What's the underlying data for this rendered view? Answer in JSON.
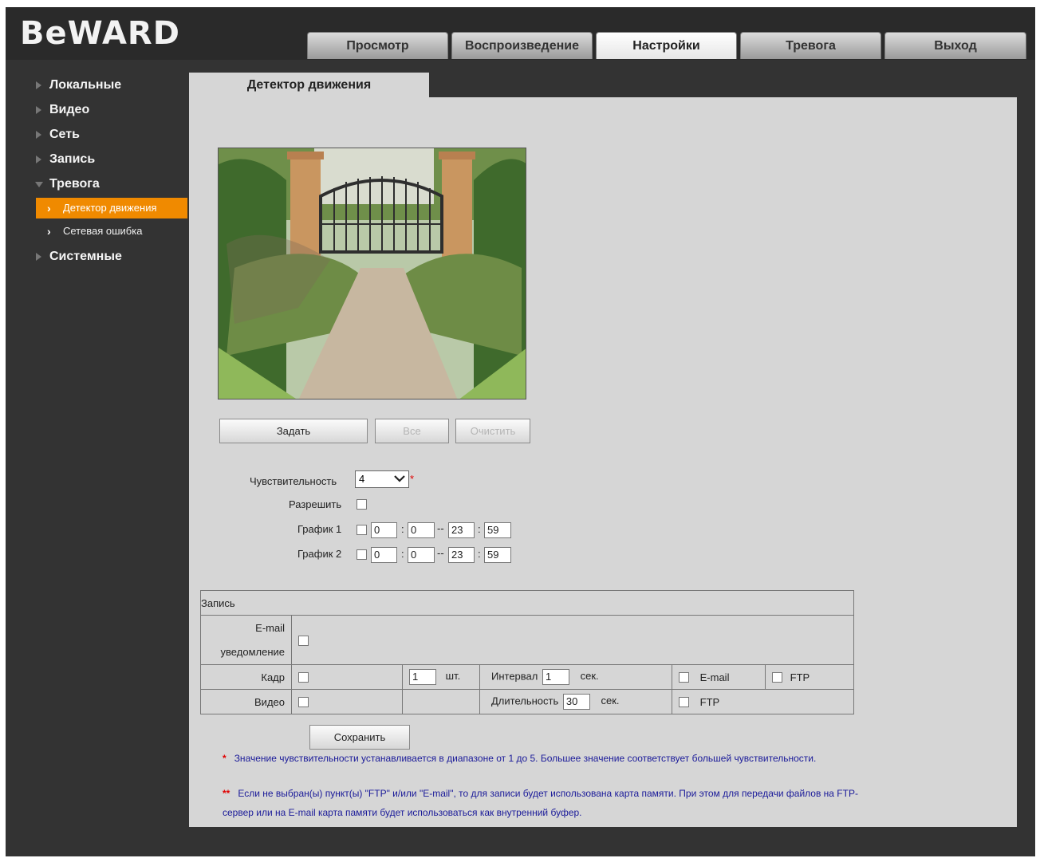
{
  "brand": {
    "logo_text": "BeWARD"
  },
  "tabs": [
    {
      "label": "Просмотр"
    },
    {
      "label": "Воспроизведение"
    },
    {
      "label": "Настройки"
    },
    {
      "label": "Тревога"
    },
    {
      "label": "Выход"
    }
  ],
  "sidebar": {
    "items": [
      {
        "label": "Локальные"
      },
      {
        "label": "Видео"
      },
      {
        "label": "Сеть"
      },
      {
        "label": "Запись"
      },
      {
        "label": "Тревога"
      },
      {
        "label": "Системные"
      }
    ],
    "subitems": [
      {
        "label": "Детектор движения"
      },
      {
        "label": "Сетевая ошибка"
      }
    ]
  },
  "page": {
    "title": "Детектор движения"
  },
  "area_buttons": {
    "set": "Задать",
    "all": "Все",
    "clear": "Очистить"
  },
  "form": {
    "sensitivity_label": "Чувствительность",
    "sensitivity_value": "4",
    "required_mark": "*",
    "enable_label": "Разрешить",
    "schedule1_label": "График 1",
    "schedule2_label": "График 2",
    "schedule1": {
      "start_h": "0",
      "start_m": "0",
      "end_h": "23",
      "end_m": "59"
    },
    "schedule2": {
      "start_h": "0",
      "start_m": "0",
      "end_h": "23",
      "end_m": "59"
    },
    "colon": ":",
    "dash": "--"
  },
  "record": {
    "header": "Запись",
    "email_label_1": "E-mail",
    "email_label_2": "уведомление",
    "frame_label": "Кадр",
    "frame_count": "1",
    "frame_unit": "шт.",
    "interval_label": "Интервал",
    "interval_value": "1",
    "sec_label": "сек.",
    "email_opt": "E-mail",
    "ftp_opt": "FTP",
    "video_label": "Видео",
    "duration_label": "Длительность",
    "duration_value": "30"
  },
  "save_label": "Сохранить",
  "notes": {
    "n1_star": "*",
    "n1": "Значение чувствительности устанавливается в диапазоне от 1 до 5. Большее значение соответствует большей чувствительности.",
    "n2_star": "**",
    "n2_line1": "Если не выбран(ы) пункт(ы) \"FTP\" и/или \"E-mail\", то для записи будет использована карта памяти. При этом для передачи файлов на FTP-",
    "n2_line2": "сервер или на E-mail карта памяти будет использоваться как внутренний буфер."
  }
}
